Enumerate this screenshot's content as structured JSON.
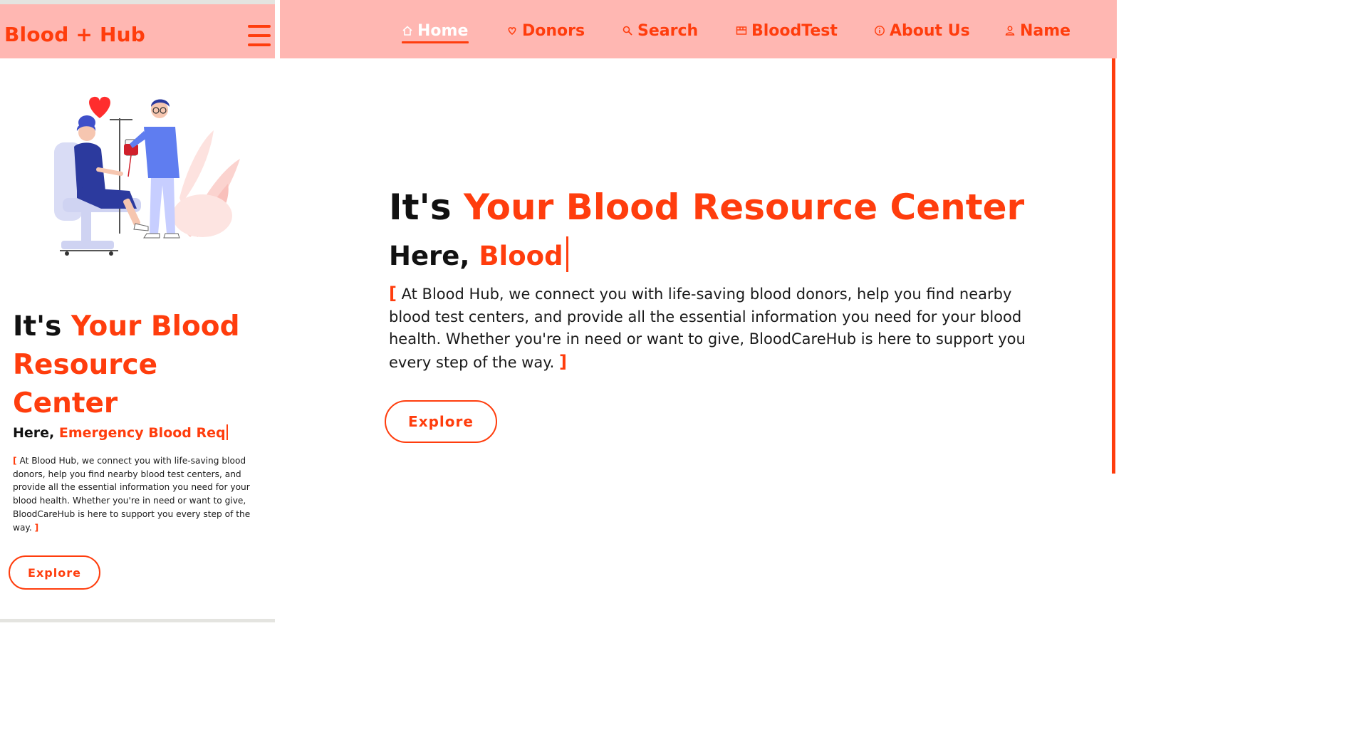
{
  "brand": {
    "accent_color": "#ff3d0d",
    "header_color": "#ffb7b2"
  },
  "mobile": {
    "logo_text": "Blood + Hub",
    "menu_icon": "hamburger-menu-icon",
    "illustration": "blood-donation-illustration",
    "title_prefix": "It's",
    "title_accent": "Your Blood Resource Center",
    "subtitle_prefix": "Here,",
    "subtitle_typed": "Emergency Blood Req",
    "paragraph_open": "[",
    "paragraph": "At Blood Hub, we connect you with life-saving blood donors, help you find nearby blood test centers, and provide all the essential information you need for your blood health. Whether you're in need or want to give, BloodCareHub is here to support you every step of the way.",
    "paragraph_close": "]",
    "explore_label": "Explore"
  },
  "desktop": {
    "nav": [
      {
        "label": "Home",
        "icon": "home-icon",
        "active": true
      },
      {
        "label": "Donors",
        "icon": "heart-hand-icon",
        "active": false
      },
      {
        "label": "Search",
        "icon": "search-icon",
        "active": false
      },
      {
        "label": "BloodTest",
        "icon": "test-tubes-icon",
        "active": false
      },
      {
        "label": "About Us",
        "icon": "info-icon",
        "active": false
      },
      {
        "label": "Name",
        "icon": "user-icon",
        "active": false
      }
    ],
    "title_prefix": "It's",
    "title_accent": "Your Blood Resource Center",
    "subtitle_prefix": "Here,",
    "subtitle_typed": "Blood",
    "paragraph_open": "[",
    "paragraph": "At Blood Hub, we connect you with life-saving blood donors, help you find nearby blood test centers, and provide all the essential information you need for your blood health. Whether you're in need or want to give, BloodCareHub is here to support you every step of the way.",
    "paragraph_close": "]",
    "explore_label": "Explore"
  }
}
